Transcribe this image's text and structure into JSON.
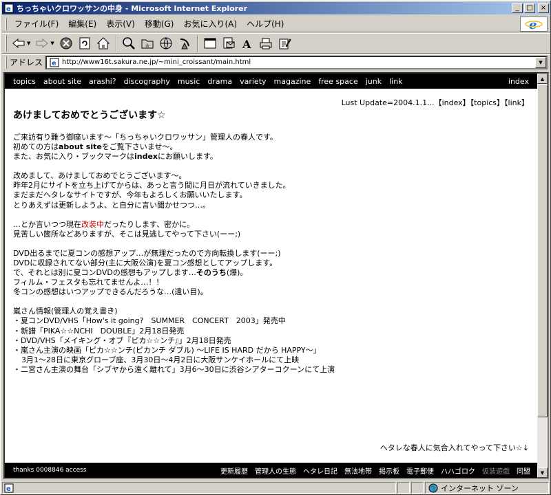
{
  "window": {
    "title": "ちっちゃいクロワッサンの中身 - Microsoft Internet Explorer",
    "min": "_",
    "max": "□",
    "close": "×"
  },
  "menu": [
    "ファイル(F)",
    "編集(E)",
    "表示(V)",
    "移動(G)",
    "お気に入り(A)",
    "ヘルプ(H)"
  ],
  "address": {
    "label": "アドレス",
    "url": "http://www16t.sakura.ne.jp/~mini_croissant/main.html"
  },
  "nav": {
    "links": [
      "topics",
      "about site",
      "arashi?",
      "discography",
      "music",
      "drama",
      "variety",
      "magazine",
      "free space",
      "junk",
      "link"
    ],
    "right": "index"
  },
  "page": {
    "last_update": "Lust Update=2004.1.1...【index】【topics】【link】",
    "headline": "あけましておめでとうございます☆",
    "p1": [
      "ご来訪有り難う御座います～「ちっちゃいクロワッサン」管理人の春人です。",
      "初めての方は",
      "about site",
      "をご覧下さいませ～。",
      "また、お気に入り・ブックマークは",
      "index",
      "にお願いします。"
    ],
    "p2": [
      "改めまして、あけましておめでとうございます～。",
      "昨年2月にサイトを立ち上げてからは、あっと言う間に月日が流れていきました。",
      "まだまだヘタレなサイトですが、今年もよろしくお願いいたします。",
      "とりあえずは更新しようよ、と自分に言い聞かせつつ…。"
    ],
    "p3": [
      "…とか言いつつ現在",
      "改装中",
      "だったりします、密かに。",
      "見苦しい箇所などありますが、そこは見逃してやって下さい(ーー;)"
    ],
    "p4": [
      "DVD出るまでに夏コンの感想アップ…が無理だったので方向転換します(ーー;)",
      "DVDに収録されてない部分(主に大阪公演)を夏コン感想としてアップします。",
      "で、それとは別に夏コンDVDの感想もアップします…",
      "そのうち",
      "(爆)。",
      "フィルム・フェスタも忘れてませんよ…！！",
      "冬コンの感想はいつアップできるんだろうな…(遠い目)。"
    ],
    "p5": [
      "嵐さん情報(管理人の覚え書き)",
      "・夏コンDVD/VHS「How's it going?　SUMMER　CONCERT　2003」発売中",
      "・新譜「PIKA☆☆NCHI　DOUBLE」2月18日発売",
      "・DVD/VHS「メイキング・オブ『ピカ☆☆ンチ』」2月18日発売",
      "・嵐さん主演の映画「ピカ☆☆ンチ(ピカンチ ダブル) ～LIFE IS HARD だから HAPPY～」",
      "3月1～28日に東京グローブ座、3月30日～4月2日に大阪サンケイホールにて上映",
      "・二宮さん主演の舞台「シブヤから遠く離れて」3月6～30日に渋谷シアターコクーンにて上演"
    ],
    "footer_msg": "ヘタレな春人に気合入れてやって下さい☆↓",
    "counter": "thanks 0008846 access",
    "foot_links": [
      "更新履歴",
      "管理人の生態",
      "ヘタレ日記",
      "無法地帯",
      "掲示板",
      "電子郵便",
      "ハハゴロク",
      "仮装遊戯",
      "同盟"
    ]
  },
  "status": {
    "zone": "インターネット ゾーン"
  },
  "colors": {
    "title_start": "#0a246a",
    "title_end": "#a6caf0",
    "chrome": "#d4d0c8",
    "nav_bg": "#000000",
    "accent_red": "#cc0000"
  }
}
